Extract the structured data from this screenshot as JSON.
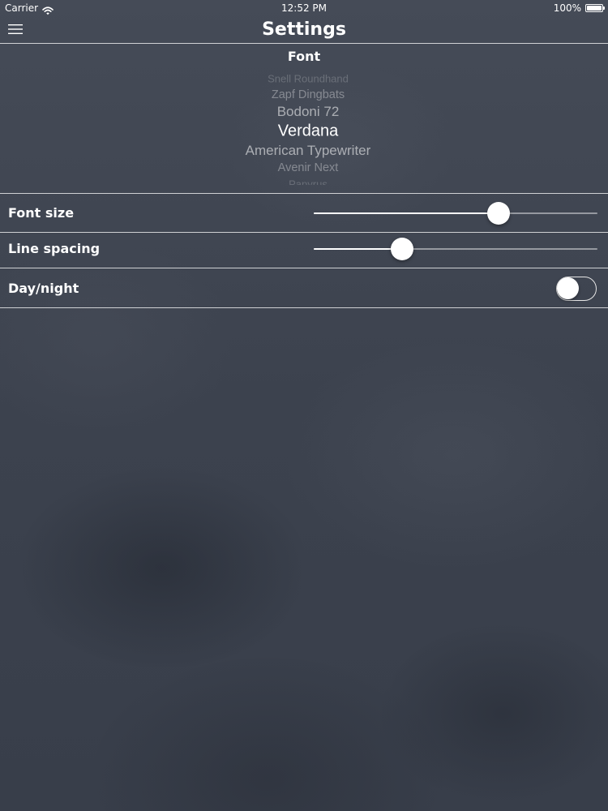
{
  "status_bar": {
    "carrier": "Carrier",
    "time": "12:52 PM",
    "battery_text": "100%",
    "battery_level": 1.0,
    "wifi_icon": "wifi-icon",
    "battery_icon": "battery-icon"
  },
  "nav": {
    "title": "Settings",
    "menu_icon": "hamburger-menu-icon"
  },
  "font_section": {
    "title": "Font",
    "picker": {
      "items": [
        "Snell Roundhand",
        "Zapf Dingbats",
        "Bodoni 72",
        "Verdana",
        "American Typewriter",
        "Avenir Next",
        "Papyrus"
      ],
      "selected": "Verdana"
    }
  },
  "settings": {
    "font_size": {
      "label": "Font size",
      "value": 0.65
    },
    "line_spacing": {
      "label": "Line spacing",
      "value": 0.31
    },
    "day_night": {
      "label": "Day/night",
      "on": false
    }
  },
  "colors": {
    "background": "#3d4350",
    "text": "#ffffff",
    "separator": "#ffffff"
  }
}
